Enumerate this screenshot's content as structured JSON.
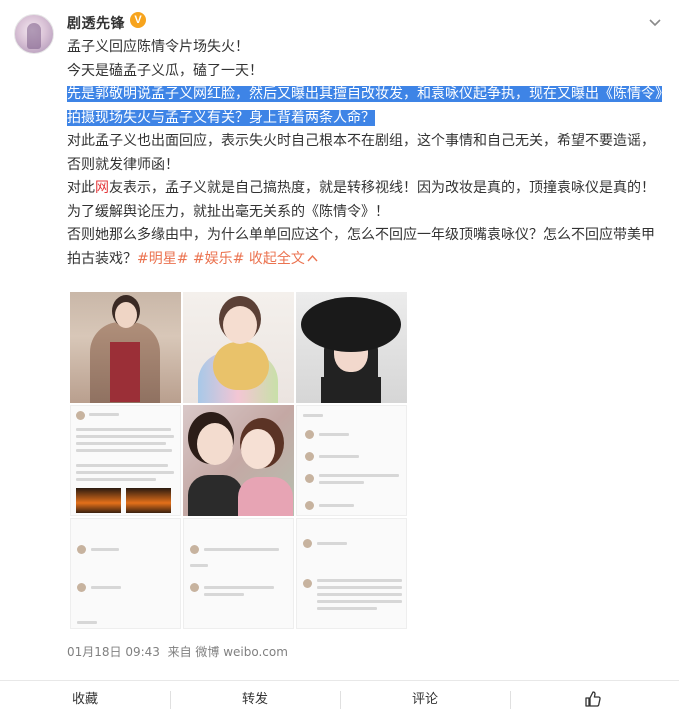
{
  "post": {
    "username": "剧透先锋",
    "verified_badge": "V",
    "lines": {
      "l1": "孟子义回应陈情令片场失火！",
      "l2": "今天是磕孟子义瓜，磕了一天！",
      "l3": "先是郭敬明说孟子义网红脸，然后又曝出其擅自改妆发，和袁咏仪起争执，现在又曝出《陈情令》拍摄现场失火与孟子义有关？身上背着两条人命？",
      "l4": "对此孟子义也出面回应，表示失火时自己根本不在剧组，这个事情和自己无关，希望不要造谣，否则就发律师函！",
      "l5_a": "对此",
      "l5_red": "网",
      "l5_b": "友表示，孟子义就是自己搞热度，就是转移视线！因为改妆是真的，顶撞袁咏仪是真的！",
      "l6": "为了缓解舆论压力，就扯出毫无关系的《陈情令》！",
      "l7": "否则她那么多缘由中，为什么单单回应这个，怎么不回应一年级顶嘴袁咏仪？怎么不回应带美甲拍古装戏？",
      "tag1": "#明星#",
      "tag2": "#娱乐#",
      "collapse": "收起全文"
    },
    "timestamp": "01月18日 09:43",
    "source": "来自 微博 weibo.com"
  },
  "actions": {
    "favorite": "收藏",
    "repost": "转发",
    "comment": "评论"
  },
  "icons": {
    "menu": "chevron-down-icon",
    "like": "thumbs-up-icon",
    "collapse": "chevron-up-icon"
  },
  "colors": {
    "highlight": "#3e84e6",
    "link": "#eb7350",
    "red_text": "#e4393c",
    "verified": "#f7a41d"
  }
}
